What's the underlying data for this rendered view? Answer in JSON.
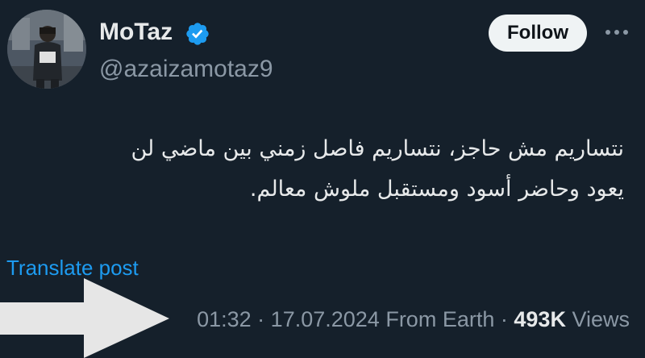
{
  "author": {
    "display_name": "MoTaz",
    "handle": "@azaizamotaz9",
    "verified": true,
    "verified_color": "#1d9bf0"
  },
  "actions": {
    "follow_label": "Follow",
    "more_icon": "more-horizontal-icon"
  },
  "tweet": {
    "text_lines": [
      "نتساريم مش حاجز، نتساريم فاصل زمني بين ماضي لن",
      "يعود  وحاضر أسود ومستقبل ملوش معالم."
    ],
    "translate_label": "Translate post"
  },
  "meta": {
    "time": "01:32",
    "date": "17.07.2024",
    "location": "From Earth",
    "separator": "·",
    "views_count": "493K",
    "views_label": "Views"
  },
  "overlay": {
    "arrow_icon": "arrow-right-icon",
    "arrow_color": "#e6e6e6"
  },
  "colors": {
    "background": "#15202b",
    "primary_text": "#e7e9ea",
    "secondary_text": "#8b98a5",
    "link": "#1d9bf0"
  }
}
